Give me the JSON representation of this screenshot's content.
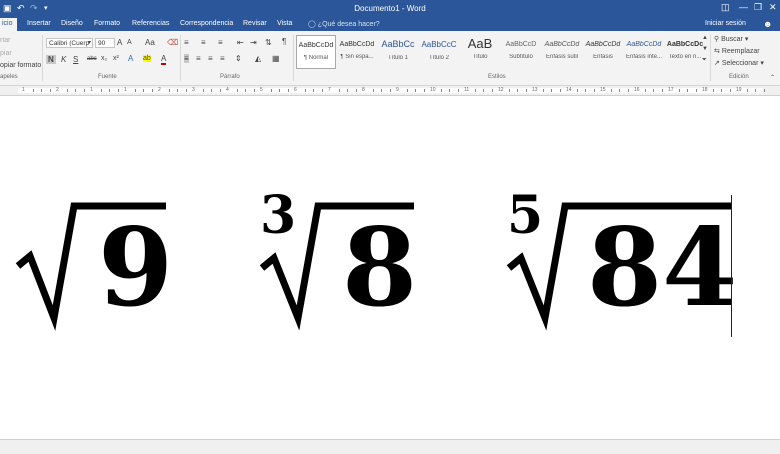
{
  "titlebar": {
    "title": "Documento1 - Word",
    "quick_access": {
      "save_icon": "save-icon",
      "undo_icon": "undo-icon",
      "redo_icon": "redo-icon",
      "customize_icon": "customize-icon"
    },
    "window_controls": {
      "ribbon_options_icon": "ribbon-display-options-icon",
      "minimize_icon": "minimize-icon",
      "restore_icon": "restore-icon",
      "close_icon": "close-icon"
    }
  },
  "tabs": [
    {
      "label": "Inicio",
      "visible_text": "icio",
      "active": true
    },
    {
      "label": "Insertar"
    },
    {
      "label": "Diseño"
    },
    {
      "label": "Formato"
    },
    {
      "label": "Referencias"
    },
    {
      "label": "Correspondencia"
    },
    {
      "label": "Revisar"
    },
    {
      "label": "Vista"
    }
  ],
  "tell_me": {
    "placeholder": "¿Qué desea hacer?",
    "icon": "lightbulb-icon"
  },
  "sign_in": "Iniciar sesión",
  "clipboard": {
    "cut_label": "rtar",
    "copy_label": "piar",
    "format_painter_label": "opiar formato",
    "group_label": "apeles"
  },
  "font": {
    "name": "Calibri (Cuerp",
    "size": "90",
    "grow_label": "A",
    "shrink_label": "A",
    "case_label": "Aa",
    "clear_icon": "clear-formatting-icon",
    "bold": "N",
    "italic": "K",
    "underline": "S",
    "strikethrough": "abc",
    "subscript": "x₂",
    "superscript": "x²",
    "effects_label": "A",
    "highlight_label": "ab",
    "color_label": "A",
    "group_label": "Fuente",
    "text_color": "#c00000",
    "highlight_color": "#ffff00"
  },
  "paragraph": {
    "group_label": "Párrafo",
    "pilcrow": "¶"
  },
  "styles": {
    "group_label": "Estilos",
    "items": [
      {
        "preview": "AaBbCcDd",
        "name": "¶ Normal",
        "active": true
      },
      {
        "preview": "AaBbCcDd",
        "name": "¶ Sin espa..."
      },
      {
        "preview": "AaBbCc",
        "name": "Título 1"
      },
      {
        "preview": "AaBbCcC",
        "name": "Título 2"
      },
      {
        "preview": "AaB",
        "name": "Título"
      },
      {
        "preview": "AaBbCcD",
        "name": "Subtítulo"
      },
      {
        "preview": "AaBbCcDd",
        "name": "Énfasis sutil"
      },
      {
        "preview": "AaBbCcDd",
        "name": "Énfasis"
      },
      {
        "preview": "AaBbCcDd",
        "name": "Énfasis inte..."
      },
      {
        "preview": "AaBbCcDc",
        "name": "Texto en n..."
      }
    ]
  },
  "editing": {
    "find_label": "Buscar",
    "replace_label": "Reemplazar",
    "select_label": "Seleccionar",
    "group_label": "Edición"
  },
  "ruler": {
    "numbers": [
      "1",
      "2",
      "1",
      "1",
      "2",
      "3",
      "4",
      "5",
      "6",
      "7",
      "8",
      "9",
      "10",
      "11",
      "12",
      "13",
      "14",
      "15",
      "16",
      "17",
      "18",
      "19"
    ]
  },
  "document": {
    "expressions": [
      {
        "index": "",
        "radicand": "9"
      },
      {
        "index": "3",
        "radicand": "8"
      },
      {
        "index": "5",
        "radicand": "84"
      }
    ]
  }
}
